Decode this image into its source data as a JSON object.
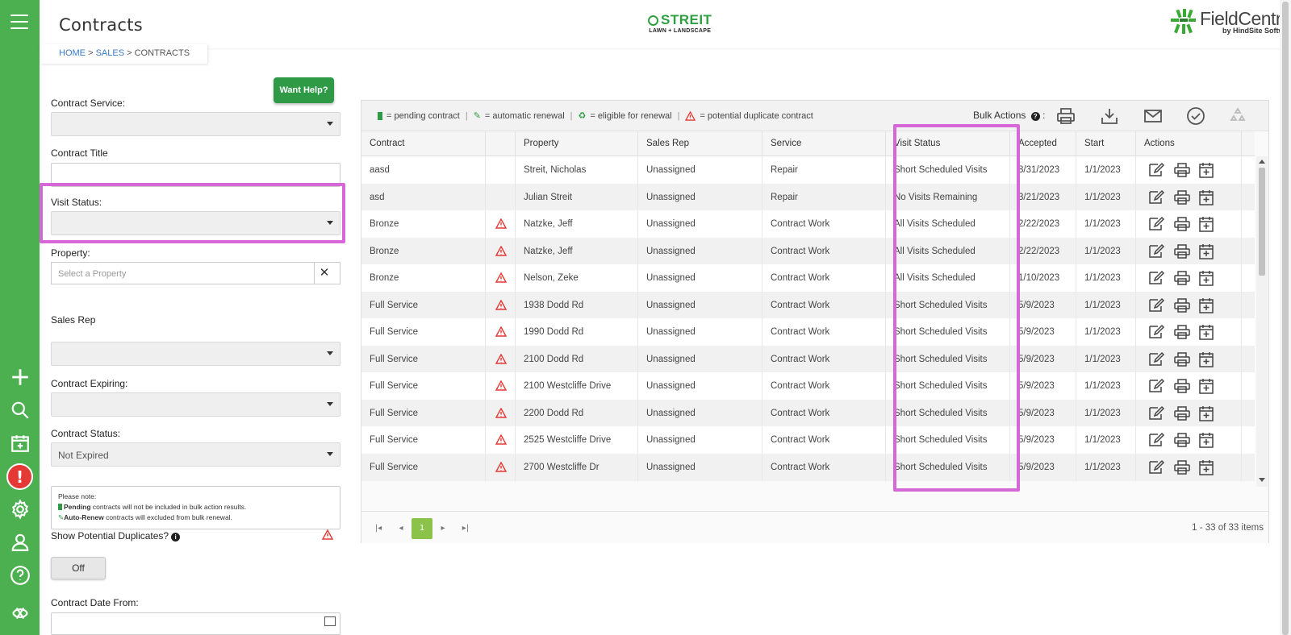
{
  "app": {
    "title": "Contracts",
    "breadcrumb": [
      "HOME",
      "SALES",
      "CONTRACTS"
    ],
    "breadcrumb_sep": ">",
    "brand_center": {
      "name": "STREIT",
      "sub": "LAWN + LANDSCAPE"
    },
    "brand_right": {
      "name": "FieldCentral",
      "by": "by HindSite Software"
    }
  },
  "colors": {
    "rail": "#4caf50",
    "accent": "#2e9a45",
    "highlight": "#d667d6",
    "warning": "#e53935",
    "pager_active": "#8bc34a"
  },
  "rail_icons": [
    "menu-icon",
    "plus-icon",
    "search-icon",
    "calendar-add-icon",
    "alert-icon",
    "gear-icon",
    "user-icon",
    "help-icon",
    "fieldcentral-logo-icon"
  ],
  "filters": {
    "help_button": "Want Help?",
    "contract_service_label": "Contract Service:",
    "contract_service_value": "",
    "contract_title_label": "Contract Title",
    "contract_title_value": "",
    "visit_status_label": "Visit Status:",
    "visit_status_value": "",
    "property_label": "Property:",
    "property_placeholder": "Select a Property",
    "property_clear": "✕",
    "sales_rep_label": "Sales Rep",
    "sales_rep_value": "",
    "contract_expiring_label": "Contract Expiring:",
    "contract_expiring_value": "",
    "contract_status_label": "Contract Status:",
    "contract_status_value": "Not Expired",
    "note_title": "Please note:",
    "note_line1_bold": "Pending",
    "note_line1_rest": " contracts will not be included in bulk action results.",
    "note_line2_bold": "Auto-Renew",
    "note_line2_rest": " contracts will excluded from bulk renewal.",
    "show_duplicates_label": "Show Potential Duplicates?",
    "show_duplicates_toggle": "Off",
    "contract_date_from_label": "Contract Date From:"
  },
  "legend": {
    "pending": "= pending contract",
    "auto_renew": "= automatic renewal",
    "eligible": "= eligible for renewal",
    "duplicate": "= potential duplicate contract",
    "sep": "|"
  },
  "bulk": {
    "label": "Bulk Actions",
    "info": "?",
    "colon": ":"
  },
  "table": {
    "headers": [
      "Contract",
      "",
      "Property",
      "Sales Rep",
      "Service",
      "Visit Status",
      "Accepted",
      "Start",
      "Actions"
    ],
    "rows": [
      {
        "contract": "aasd",
        "dup": false,
        "property": "Streit, Nicholas",
        "sales_rep": "Unassigned",
        "service": "Repair",
        "visit_status": "Short Scheduled Visits",
        "accepted": "8/31/2023",
        "start": "1/1/2023"
      },
      {
        "contract": "asd",
        "dup": false,
        "property": "Julian Streit",
        "sales_rep": "Unassigned",
        "service": "Repair",
        "visit_status": "No Visits Remaining",
        "accepted": "3/21/2023",
        "start": "1/1/2023"
      },
      {
        "contract": "Bronze",
        "dup": true,
        "property": "Natzke, Jeff",
        "sales_rep": "Unassigned",
        "service": "Contract Work",
        "visit_status": "All Visits Scheduled",
        "accepted": "2/22/2023",
        "start": "1/1/2023"
      },
      {
        "contract": "Bronze",
        "dup": true,
        "property": "Natzke, Jeff",
        "sales_rep": "Unassigned",
        "service": "Contract Work",
        "visit_status": "All Visits Scheduled",
        "accepted": "2/22/2023",
        "start": "1/1/2023"
      },
      {
        "contract": "Bronze",
        "dup": true,
        "property": "Nelson, Zeke",
        "sales_rep": "Unassigned",
        "service": "Contract Work",
        "visit_status": "All Visits Scheduled",
        "accepted": "1/10/2023",
        "start": "1/1/2023"
      },
      {
        "contract": "Full Service",
        "dup": true,
        "property": "1938 Dodd Rd",
        "sales_rep": "Unassigned",
        "service": "Contract Work",
        "visit_status": "Short Scheduled Visits",
        "accepted": "5/9/2023",
        "start": "1/1/2023"
      },
      {
        "contract": "Full Service",
        "dup": true,
        "property": "1990 Dodd Rd",
        "sales_rep": "Unassigned",
        "service": "Contract Work",
        "visit_status": "Short Scheduled Visits",
        "accepted": "5/9/2023",
        "start": "1/1/2023"
      },
      {
        "contract": "Full Service",
        "dup": true,
        "property": "2100 Dodd Rd",
        "sales_rep": "Unassigned",
        "service": "Contract Work",
        "visit_status": "Short Scheduled Visits",
        "accepted": "5/9/2023",
        "start": "1/1/2023"
      },
      {
        "contract": "Full Service",
        "dup": true,
        "property": "2100 Westcliffe Drive",
        "sales_rep": "Unassigned",
        "service": "Contract Work",
        "visit_status": "Short Scheduled Visits",
        "accepted": "5/9/2023",
        "start": "1/1/2023"
      },
      {
        "contract": "Full Service",
        "dup": true,
        "property": "2200 Dodd Rd",
        "sales_rep": "Unassigned",
        "service": "Contract Work",
        "visit_status": "Short Scheduled Visits",
        "accepted": "5/9/2023",
        "start": "1/1/2023"
      },
      {
        "contract": "Full Service",
        "dup": true,
        "property": "2525 Westcliffe Drive",
        "sales_rep": "Unassigned",
        "service": "Contract Work",
        "visit_status": "Short Scheduled Visits",
        "accepted": "5/9/2023",
        "start": "1/1/2023"
      },
      {
        "contract": "Full Service",
        "dup": true,
        "property": "2700 Westcliffe Dr",
        "sales_rep": "Unassigned",
        "service": "Contract Work",
        "visit_status": "Short Scheduled Visits",
        "accepted": "5/9/2023",
        "start": "1/1/2023"
      }
    ]
  },
  "pager": {
    "first": "|◂",
    "prev": "◂",
    "current": "1",
    "next": "▸",
    "last": "▸|",
    "info": "1 - 33 of 33 items"
  }
}
